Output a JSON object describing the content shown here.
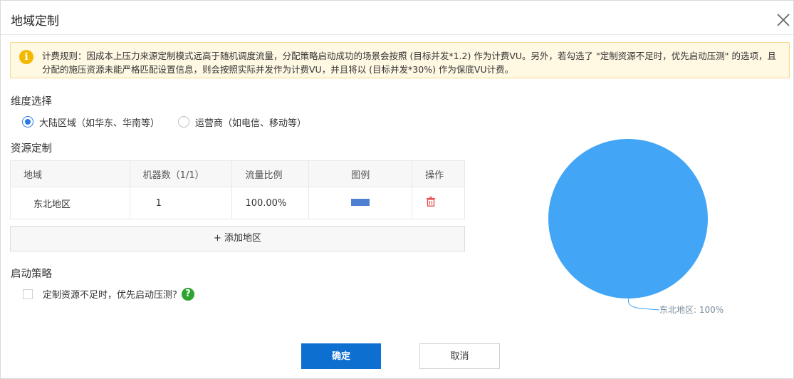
{
  "dialog": {
    "title": "地域定制",
    "close_icon": "close-icon"
  },
  "notice": {
    "icon": "info-icon",
    "icon_glyph": "i",
    "text": "计费规则：因成本上压力来源定制模式远高于随机调度流量，分配策略启动成功的场景会按照 (目标并发*1.2) 作为计费VU。另外，若勾选了 \"定制资源不足时，优先启动压测\" 的选项，且分配的施压资源未能严格匹配设置信息，则会按照实际并发作为计费VU，并且将以 (目标并发*30%) 作为保底VU计费。"
  },
  "dimension": {
    "label": "维度选择",
    "options": [
      {
        "label": "大陆区域（如华东、华南等）",
        "checked": true
      },
      {
        "label": "运营商（如电信、移动等）",
        "checked": false
      }
    ]
  },
  "resource": {
    "label": "资源定制",
    "columns": [
      "地域",
      "机器数（1/1）",
      "流量比例",
      "图例",
      "操作"
    ],
    "rows": [
      {
        "region": "东北地区",
        "machines": "1",
        "ratio": "100.00%",
        "legend_color": "#4e7fd0",
        "action_icon": "trash-icon"
      }
    ],
    "add_label": "+ 添加地区"
  },
  "strategy": {
    "label": "启动策略",
    "checkbox_label": "定制资源不足时，优先启动压测?",
    "checked": false,
    "help_icon": "help-icon",
    "help_glyph": "?"
  },
  "chart_data": {
    "type": "pie",
    "slices": [
      {
        "label": "东北地区",
        "value": 100,
        "color": "#42a5f5"
      }
    ],
    "annotations": [
      "东北地区: 100%"
    ]
  },
  "footer": {
    "confirm_label": "确定",
    "cancel_label": "取消"
  },
  "colors": {
    "primary": "#0d6fcf",
    "notice_bg": "#fff8e3",
    "warning": "#f5b800",
    "danger": "#e94e4e",
    "help": "#2ea32e"
  }
}
